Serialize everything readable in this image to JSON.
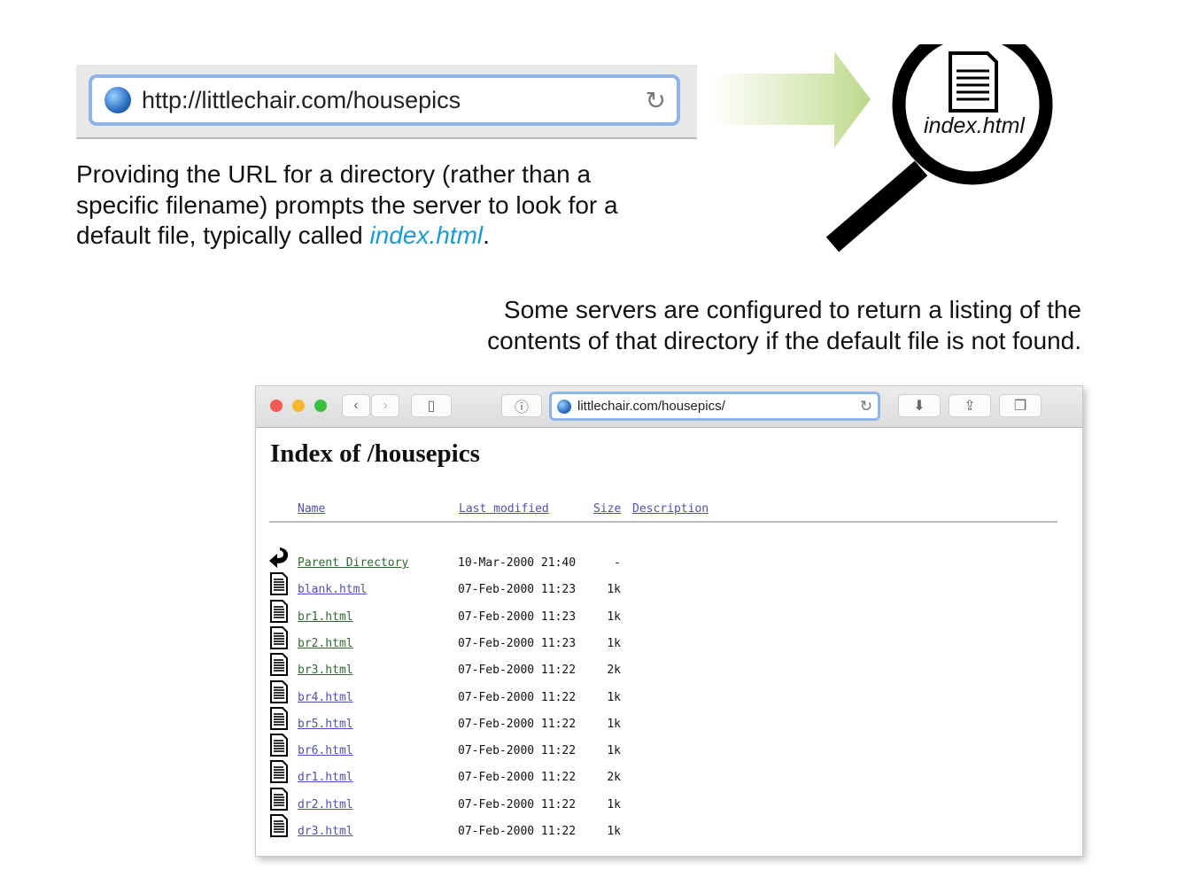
{
  "top_browser": {
    "url": "http://littlechair.com/housepics"
  },
  "explanation_1": {
    "text": "Providing the URL for a directory (rather than a specific filename) prompts the server to look for a default file, typically called ",
    "emphasis": "index.html",
    "end": "."
  },
  "magnifier": {
    "label": "index.html"
  },
  "explanation_2": {
    "line1": "Some servers are configured to return a listing of the",
    "line2": "contents  of that directory if the default file is not found."
  },
  "browser": {
    "address": "littlechair.com/housepics/"
  },
  "page": {
    "title": "Index of /housepics",
    "columns": {
      "name": "Name",
      "modified": "Last modified",
      "size": "Size",
      "description": "Description"
    },
    "rows": [
      {
        "name": "Parent Directory",
        "modified": "10-Mar-2000 21:40",
        "size": "-",
        "visited": true,
        "icon": "back"
      },
      {
        "name": "blank.html",
        "modified": "07-Feb-2000 11:23",
        "size": "1k",
        "visited": false
      },
      {
        "name": "br1.html",
        "modified": "07-Feb-2000 11:23",
        "size": "1k",
        "visited": true
      },
      {
        "name": "br2.html",
        "modified": "07-Feb-2000 11:23",
        "size": "1k",
        "visited": true
      },
      {
        "name": "br3.html",
        "modified": "07-Feb-2000 11:22",
        "size": "2k",
        "visited": true
      },
      {
        "name": "br4.html",
        "modified": "07-Feb-2000 11:22",
        "size": "1k",
        "visited": false
      },
      {
        "name": "br5.html",
        "modified": "07-Feb-2000 11:22",
        "size": "1k",
        "visited": false
      },
      {
        "name": "br6.html",
        "modified": "07-Feb-2000 11:22",
        "size": "1k",
        "visited": false
      },
      {
        "name": "dr1.html",
        "modified": "07-Feb-2000 11:22",
        "size": "2k",
        "visited": false
      },
      {
        "name": "dr2.html",
        "modified": "07-Feb-2000 11:22",
        "size": "1k",
        "visited": false
      },
      {
        "name": "dr3.html",
        "modified": "07-Feb-2000 11:22",
        "size": "1k",
        "visited": false
      }
    ]
  }
}
